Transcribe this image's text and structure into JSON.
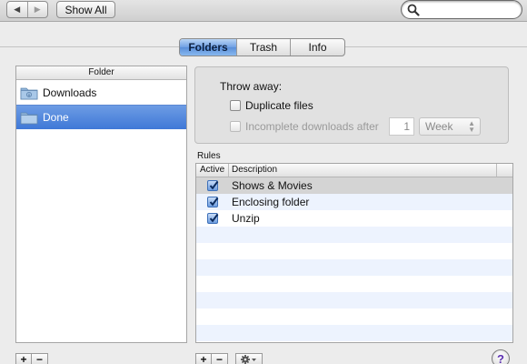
{
  "toolbar": {
    "back_icon": "triangle-left-icon",
    "forward_icon": "triangle-right-icon",
    "show_all_label": "Show All",
    "search": {
      "value": "",
      "placeholder": ""
    }
  },
  "tabs": [
    {
      "label": "Folders",
      "active": true
    },
    {
      "label": "Trash",
      "active": false
    },
    {
      "label": "Info",
      "active": false
    }
  ],
  "folders": {
    "header": "Folder",
    "items": [
      {
        "label": "Downloads",
        "selected": false
      },
      {
        "label": "Done",
        "selected": true
      }
    ],
    "add_label": "+",
    "remove_label": "−"
  },
  "throw_away": {
    "title": "Throw away:",
    "duplicate_label": "Duplicate files",
    "duplicate_checked": false,
    "incomplete_label": "Incomplete downloads after",
    "incomplete_checked": false,
    "incomplete_count": "1",
    "incomplete_unit": "Week"
  },
  "rules": {
    "label": "Rules",
    "columns": [
      "Active",
      "Description"
    ],
    "items": [
      {
        "description": "Shows & Movies",
        "active": true
      },
      {
        "description": "Enclosing folder",
        "active": true
      },
      {
        "description": "Unzip",
        "active": true
      }
    ],
    "add_label": "+",
    "remove_label": "−"
  },
  "help_label": "?",
  "colors": {
    "selection": "#3f78d7",
    "alt_row": "#edf3fe",
    "checkbox": "#6d9de0"
  }
}
